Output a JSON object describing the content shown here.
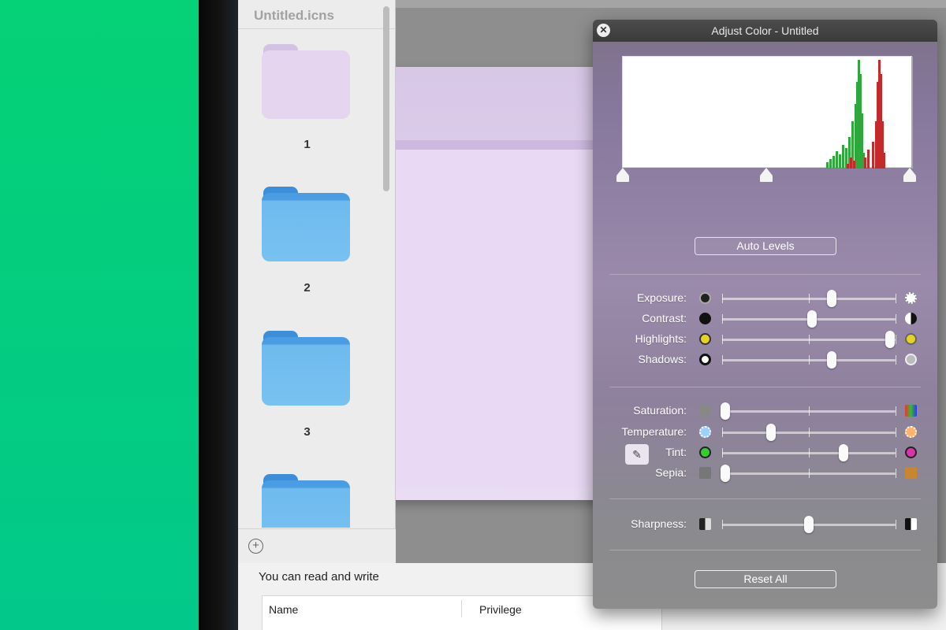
{
  "sidebar": {
    "title": "Untitled.icns",
    "slots": [
      {
        "number": "1",
        "variant": "pink"
      },
      {
        "number": "2",
        "variant": "blue"
      },
      {
        "number": "3",
        "variant": "blue"
      },
      {
        "number": "",
        "variant": "blue"
      }
    ],
    "add_icon": "plus-circle-icon"
  },
  "permissions": {
    "summary": "You can read and write",
    "columns": [
      "Name",
      "Privilege"
    ]
  },
  "adjust_color": {
    "title": "Adjust Color - Untitled",
    "auto_levels_label": "Auto Levels",
    "reset_all_label": "Reset All",
    "sliders": [
      {
        "label": "Exposure:",
        "value": 0.63,
        "left_icon": "exposure-low-icon",
        "right_icon": "exposure-high-icon"
      },
      {
        "label": "Contrast:",
        "value": 0.52,
        "left_icon": "contrast-low-icon",
        "right_icon": "contrast-high-icon"
      },
      {
        "label": "Highlights:",
        "value": 0.97,
        "left_icon": "highlights-low-icon",
        "right_icon": "highlights-high-icon"
      },
      {
        "label": "Shadows:",
        "value": 0.63,
        "left_icon": "shadows-low-icon",
        "right_icon": "shadows-high-icon"
      },
      {
        "label": "Saturation:",
        "value": 0.02,
        "left_icon": "saturation-low-icon",
        "right_icon": "saturation-high-icon"
      },
      {
        "label": "Temperature:",
        "value": 0.28,
        "left_icon": "temperature-cool-icon",
        "right_icon": "temperature-warm-icon"
      },
      {
        "label": "Tint:",
        "value": 0.7,
        "left_icon": "tint-green-icon",
        "right_icon": "tint-magenta-icon"
      },
      {
        "label": "Sepia:",
        "value": 0.02,
        "left_icon": "sepia-low-icon",
        "right_icon": "sepia-high-icon"
      },
      {
        "label": "Sharpness:",
        "value": 0.5,
        "left_icon": "sharpness-low-icon",
        "right_icon": "sharpness-high-icon"
      }
    ],
    "histogram_colors": {
      "green": "#2ea83a",
      "red": "#c42a2a"
    }
  },
  "colors": {
    "accent_green": "#05d176",
    "folder_blue": "#78c2f1",
    "folder_pink": "#e5d5ef"
  }
}
